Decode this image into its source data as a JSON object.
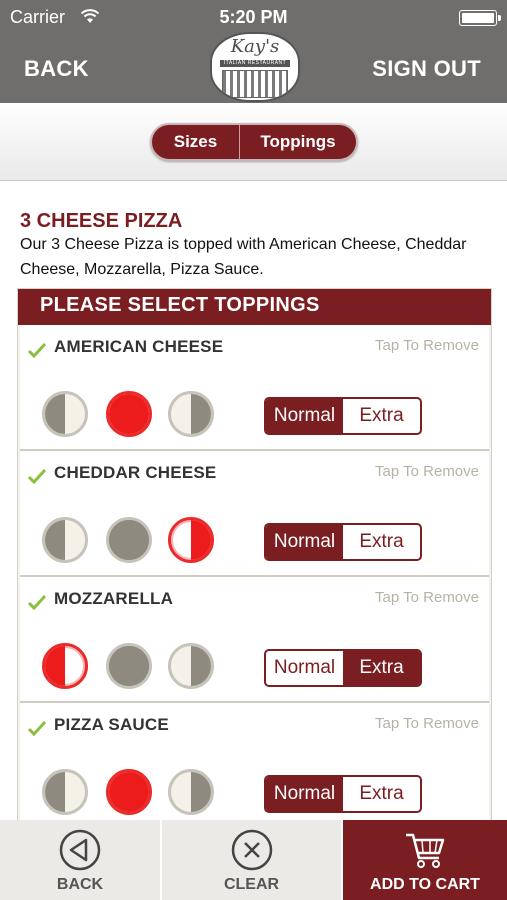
{
  "status_bar": {
    "carrier": "Carrier",
    "time": "5:20 PM"
  },
  "header": {
    "back_label": "BACK",
    "signout_label": "SIGN OUT",
    "logo_script": "Kay's",
    "logo_sub": "ITALIAN RESTAURANT"
  },
  "tabs": {
    "sizes": "Sizes",
    "toppings": "Toppings"
  },
  "item": {
    "title": "3 CHEESE PIZZA",
    "description": "Our 3 Cheese Pizza is topped with American Cheese, Cheddar Cheese, Mozzarella, Pizza Sauce."
  },
  "panel": {
    "header": "PLEASE SELECT TOPPINGS"
  },
  "toppings": [
    {
      "name": "AMERICAN CHEESE",
      "remove": "Tap To Remove",
      "normal": "Normal",
      "extra": "Extra"
    },
    {
      "name": "CHEDDAR CHEESE",
      "remove": "Tap To Remove",
      "normal": "Normal",
      "extra": "Extra"
    },
    {
      "name": "MOZZARELLA",
      "remove": "Tap To Remove",
      "normal": "Normal",
      "extra": "Extra"
    },
    {
      "name": "PIZZA SAUCE",
      "remove": "Tap To Remove",
      "normal": "Normal",
      "extra": "Extra"
    }
  ],
  "bottom_bar": {
    "back": "BACK",
    "clear": "CLEAR",
    "cart": "ADD TO CART"
  },
  "colors": {
    "brand": "#7a1e22",
    "header_gray": "#6f6e6c",
    "selected_red": "#ed1c1c",
    "check_green": "#8cbf3f"
  }
}
